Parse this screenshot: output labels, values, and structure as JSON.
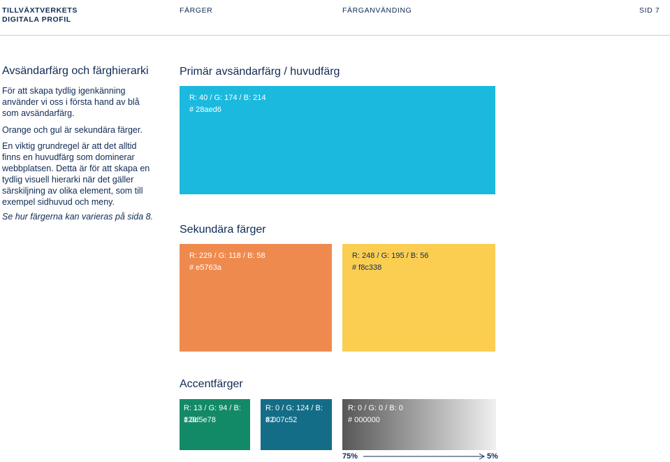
{
  "header": {
    "org_line1": "TILLVÄXTVERKETS",
    "org_line2": "DIGITALA PROFIL",
    "section": "FÄRGER",
    "subsection": "FÄRGANVÄNDING",
    "page": "SID 7"
  },
  "intro": {
    "title": "Avsändarfärg och färghierarki",
    "p1": "För att skapa tydlig igenkänning använder vi oss i första hand av blå som avsändarfärg.",
    "p2": "Orange och gul är sekundära färger.",
    "p3": "En viktig grundregel är att det alltid finns en huvudfärg som dominerar webbplatsen. Detta är för att skapa en tydlig visuell hierarki när det gäller särskiljning av olika element, som till exempel sidhuvud och meny.",
    "p4": "Se hur färgerna kan varieras på sida 8."
  },
  "primary": {
    "title": "Primär avsändarfärg / huvudfärg",
    "rgb": "R: 40 / G: 174 / B: 214",
    "hex": "# 28aed6",
    "color": "#1cb9de"
  },
  "secondary": {
    "title": "Sekundära färger",
    "orange": {
      "rgb": "R: 229 / G: 118 / B: 58",
      "hex": "# e5763a",
      "color": "#ef8a4e"
    },
    "yellow": {
      "rgb": "R: 248 / G: 195 / B: 56",
      "hex": "# f8c338",
      "color": "#fbce52"
    }
  },
  "accent": {
    "title": "Accentfärger",
    "green": {
      "rgb": "R: 13 / G: 94 / B: 120",
      "hex": "# 0d5e78",
      "color": "#138a67"
    },
    "teal": {
      "rgb": "R: 0 / G: 124 / B: 82",
      "hex": "# 007c52",
      "color": "#136d87"
    },
    "black": {
      "rgb": "R: 0 / G: 0 / B: 0",
      "hex": "# 000000",
      "gradient_from": "#575757",
      "gradient_to": "#f0f0f0"
    },
    "scale_from": "75%",
    "scale_to": "5%"
  }
}
